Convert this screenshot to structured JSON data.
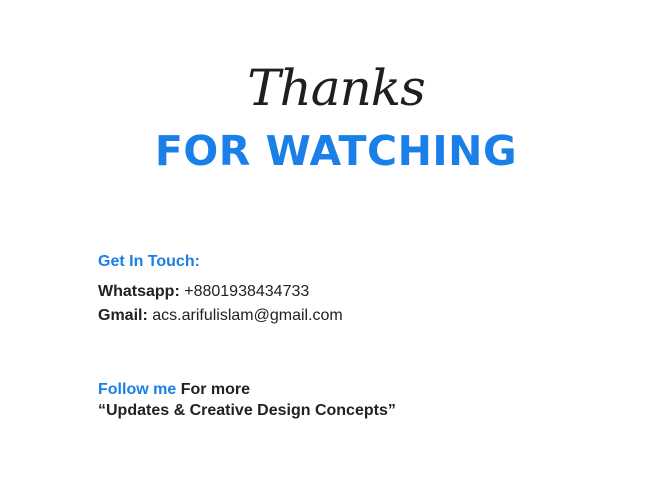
{
  "colors": {
    "accent": "#1a7fe8",
    "text": "#222222",
    "background": "#ffffff"
  },
  "hero": {
    "script_text": "Thanks",
    "headline": "FOR WATCHING"
  },
  "contact": {
    "heading": "Get In Touch:",
    "whatsapp_label": "Whatsapp:",
    "whatsapp_value": "+8801938434733",
    "gmail_label": "Gmail:",
    "gmail_value": "acs.arifulislam@gmail.com"
  },
  "follow": {
    "highlight": "Follow me",
    "rest": "For more",
    "tagline": "“Updates & Creative Design Concepts”"
  }
}
